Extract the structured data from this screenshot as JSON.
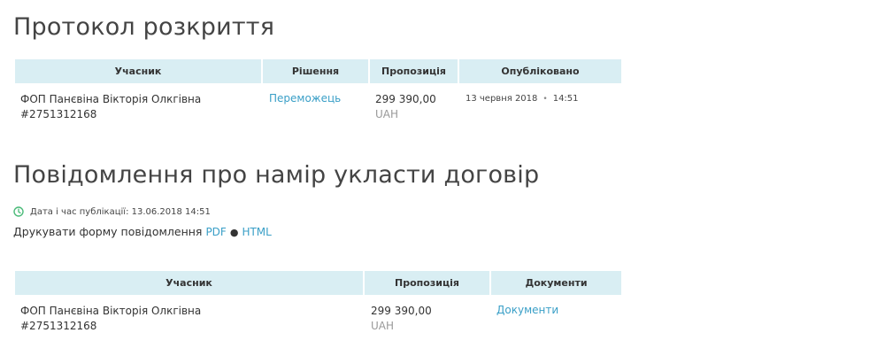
{
  "protocol": {
    "title": "Протокол розкриття",
    "headers": [
      "Учасник",
      "Рішення",
      "Пропозиція",
      "Опубліковано"
    ],
    "row": {
      "participant_name": "ФОП Панєвіна Вікторія Олкгівна",
      "participant_code": "#2751312168",
      "decision": "Переможець",
      "amount": "299 390,00",
      "currency": "UAH",
      "published_date": "13 червня 2018",
      "published_time": "14:51"
    }
  },
  "notice": {
    "title": "Повідомлення про намір укласти договір",
    "publication_info": "Дата і час публікації: 13.06.2018 14:51",
    "print_label": "Друкувати форму повідомлення",
    "pdf_link": "PDF",
    "separator": "●",
    "html_link": "HTML",
    "headers": [
      "Учасник",
      "Пропозиція",
      "Документи"
    ],
    "row": {
      "participant_name": "ФОП Панєвіна Вікторія Олкгівна",
      "participant_code": "#2751312168",
      "amount": "299 390,00",
      "currency": "UAH",
      "documents_link": "Документи"
    }
  },
  "colors": {
    "header_bg": "#d9eef3",
    "link": "#3a9fc7",
    "clock_icon": "#4cbb7a",
    "muted": "#999999"
  }
}
